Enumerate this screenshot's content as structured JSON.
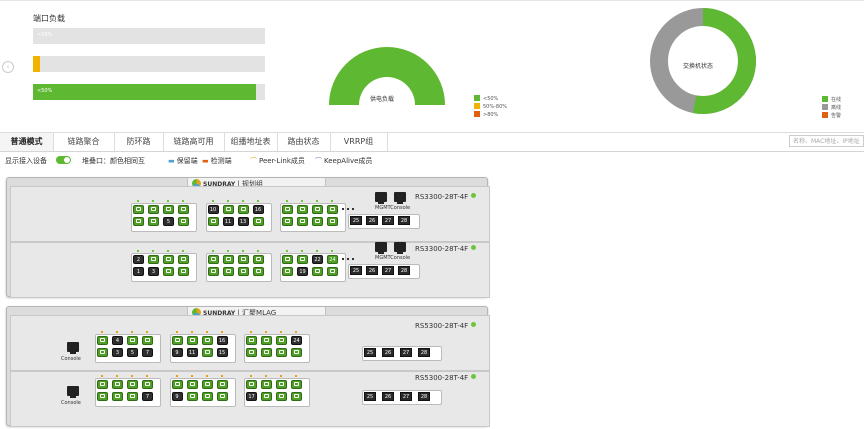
{
  "load": {
    "title": "端口负载",
    "bars": [
      {
        "label": "<50%",
        "fraction": 0.0,
        "color": "#e3e3e3"
      },
      {
        "label": "",
        "fraction": 0.03,
        "color": "#f0b400"
      },
      {
        "label": "<50%",
        "fraction": 0.96,
        "color": "#5fb832"
      }
    ]
  },
  "power": {
    "label": "供电负载",
    "legend": [
      {
        "label": "<50%",
        "color": "#5fb832"
      },
      {
        "label": "50%-80%",
        "color": "#f0b400"
      },
      {
        "label": ">80%",
        "color": "#e06010"
      }
    ],
    "gauge_fraction": 1.0
  },
  "switch_status": {
    "label": "交换机状态",
    "legend": [
      {
        "label": "在线",
        "color": "#5fb832"
      },
      {
        "label": "离线",
        "color": "#999999"
      },
      {
        "label": "告警",
        "color": "#e06010"
      }
    ],
    "online_fraction": 0.53
  },
  "tabs": [
    "普通模式",
    "链路聚合",
    "防环路",
    "链路高可用",
    "组播地址表",
    "路由状态",
    "VRRP组"
  ],
  "search_placeholder": "名称、MAC地址、IP地址",
  "options": {
    "show_devices": "显示接入设备",
    "stack_port_note": "堆叠口：颜色相同互",
    "legend_items": [
      "保留端",
      "检测端",
      "Peer-Link成员",
      "KeepAlive成员"
    ],
    "legend_colors": [
      "#4aa3d8",
      "#e06010",
      "#e5a21a",
      "#8a6bd6"
    ]
  },
  "groups": [
    {
      "brand": "SUNDRAY",
      "name": "规划组",
      "switches": [
        {
          "model": "RS3300-28T-4F",
          "status_color": "#6cc63c",
          "mgmt_label": "MGMT",
          "console_label": "Console",
          "top": [
            "g",
            "g",
            "g",
            "g",
            "10",
            "g",
            "g",
            "16",
            "g",
            "g",
            "g",
            "g"
          ],
          "bottom": [
            "g",
            "g",
            "5",
            "g",
            "g",
            "11",
            "13",
            "g",
            "g",
            "g",
            "g",
            "g"
          ],
          "sfp": [
            "25",
            "26",
            "27",
            "28"
          ]
        },
        {
          "model": "RS3300-28T-4F",
          "status_color": "#6cc63c",
          "mgmt_label": "MGMT",
          "console_label": "Console",
          "top": [
            "2",
            "g",
            "g",
            "g",
            "g",
            "g",
            "g",
            "g",
            "g",
            "g",
            "22",
            "24"
          ],
          "bottom": [
            "1",
            "3",
            "g",
            "g",
            "g",
            "g",
            "g",
            "g",
            "g",
            "19",
            "g",
            "g"
          ],
          "sfp": [
            "25",
            "26",
            "27",
            "28"
          ]
        }
      ]
    },
    {
      "brand": "SUNDRAY",
      "name": "汇聚MLAG",
      "switches": [
        {
          "model": "RS5300-28T-4F",
          "status_color": "#6cc63c",
          "console_label": "Console",
          "top": [
            "g",
            "4",
            "g",
            "g",
            "g",
            "g",
            "g",
            "16",
            "g",
            "g",
            "g",
            "24"
          ],
          "bottom": [
            "g",
            "3",
            "5",
            "7",
            "9",
            "11",
            "g",
            "15",
            "g",
            "g",
            "g",
            "g"
          ],
          "sfp": [
            "25",
            "26",
            "27",
            "28"
          ]
        },
        {
          "model": "RS5300-28T-4F",
          "status_color": "#6cc63c",
          "console_label": "Console",
          "top": [
            "g",
            "g",
            "g",
            "g",
            "g",
            "g",
            "g",
            "g",
            "g",
            "g",
            "g",
            "g"
          ],
          "bottom": [
            "g",
            "g",
            "g",
            "7",
            "9",
            "g",
            "g",
            "g",
            "17",
            "g",
            "g",
            "g"
          ],
          "sfp": [
            "25",
            "26",
            "27",
            "28"
          ]
        }
      ]
    }
  ]
}
